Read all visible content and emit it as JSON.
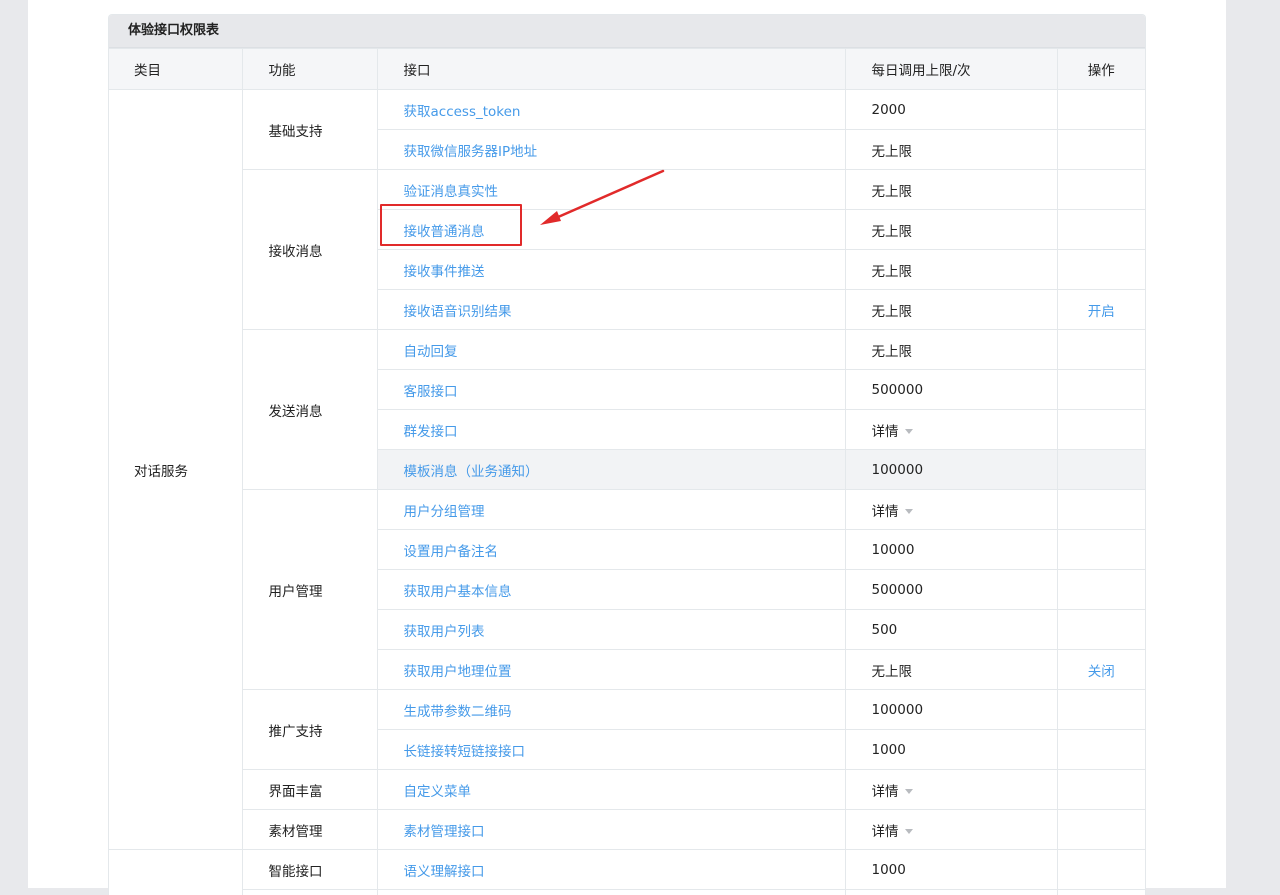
{
  "panel": {
    "title": "体验接口权限表"
  },
  "table": {
    "headers": [
      "类目",
      "功能",
      "接口",
      "每日调用上限/次",
      "操作"
    ],
    "category_1": "对话服务",
    "groups": [
      {
        "name": "基础支持",
        "rows": [
          {
            "api": "获取access_token",
            "limit": "2000"
          },
          {
            "api": "获取微信服务器IP地址",
            "limit": "无上限"
          }
        ]
      },
      {
        "name": "接收消息",
        "rows": [
          {
            "api": "验证消息真实性",
            "limit": "无上限"
          },
          {
            "api": "接收普通消息",
            "limit": "无上限"
          },
          {
            "api": "接收事件推送",
            "limit": "无上限"
          },
          {
            "api": "接收语音识别结果",
            "limit": "无上限",
            "op": "开启"
          }
        ]
      },
      {
        "name": "发送消息",
        "rows": [
          {
            "api": "自动回复",
            "limit": "无上限"
          },
          {
            "api": "客服接口",
            "limit": "500000"
          },
          {
            "api": "群发接口",
            "limit": "详情"
          },
          {
            "api": "模板消息（业务通知）",
            "limit": "100000"
          }
        ]
      },
      {
        "name": "用户管理",
        "rows": [
          {
            "api": "用户分组管理",
            "limit": "详情"
          },
          {
            "api": "设置用户备注名",
            "limit": "10000"
          },
          {
            "api": "获取用户基本信息",
            "limit": "500000"
          },
          {
            "api": "获取用户列表",
            "limit": "500"
          },
          {
            "api": "获取用户地理位置",
            "limit": "无上限",
            "op": "关闭"
          }
        ]
      },
      {
        "name": "推广支持",
        "rows": [
          {
            "api": "生成带参数二维码",
            "limit": "100000"
          },
          {
            "api": "长链接转短链接接口",
            "limit": "1000"
          }
        ]
      },
      {
        "name": "界面丰富",
        "rows": [
          {
            "api": "自定义菜单",
            "limit": "详情"
          }
        ]
      },
      {
        "name": "素材管理",
        "rows": [
          {
            "api": "素材管理接口",
            "limit": "详情"
          }
        ]
      },
      {
        "name": "智能接口",
        "rows": [
          {
            "api": "语义理解接口",
            "limit": "1000"
          }
        ]
      }
    ]
  },
  "colors": {
    "link": "#459ae9",
    "annotation": "#e12a2a",
    "header_bg": "#e7e8eb"
  }
}
